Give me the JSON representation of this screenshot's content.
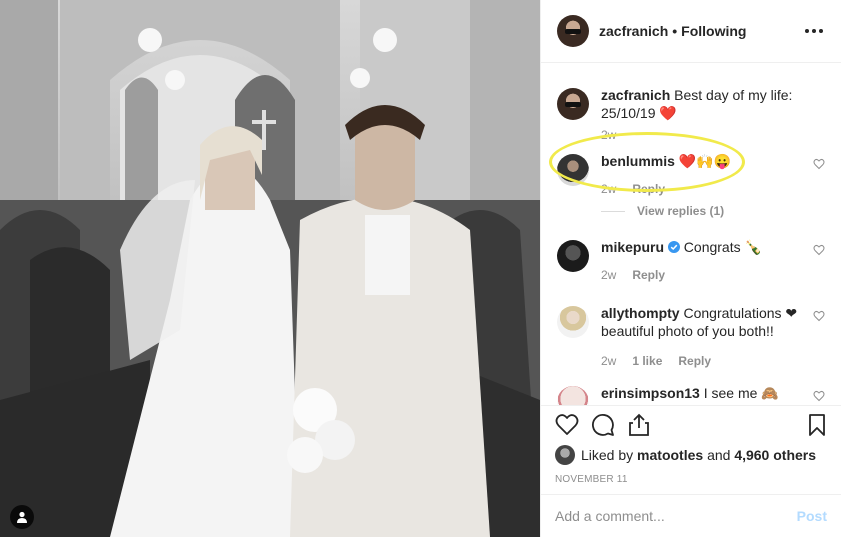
{
  "post": {
    "photo_alt": "",
    "username": "zacfranich",
    "separator": "•",
    "follow_status": "Following",
    "more_icon": "more-options-icon"
  },
  "caption": {
    "username": "zacfranich",
    "text": "Best day of my life: 25/10/19 ❤️",
    "time": "2w"
  },
  "comments": [
    {
      "username": "benlummis",
      "text": "❤️🙌😛",
      "time": "2w",
      "likes": "",
      "reply": "Reply",
      "view_replies": "View replies (1)"
    },
    {
      "username": "mikepuru",
      "text": "Congrats 🍾",
      "time": "2w",
      "likes": "",
      "reply": "Reply",
      "verified": true
    },
    {
      "username": "allythompty",
      "text": "Congratulations ❤ beautiful photo of you both!!",
      "time": "2w",
      "likes": "1 like",
      "reply": "Reply"
    },
    {
      "username": "erinsimpson13",
      "text": "I see me 🙈"
    }
  ],
  "actions": {
    "like_icon": "heart-icon",
    "comment_icon": "comment-icon",
    "share_icon": "share-icon",
    "save_icon": "bookmark-icon"
  },
  "likes": {
    "prefix": "Liked by",
    "first_user": "matootles",
    "conj": "and",
    "others": "4,960 others"
  },
  "date": "NOVEMBER 11",
  "add_comment": {
    "placeholder": "Add a comment...",
    "post_label": "Post"
  },
  "colors": {
    "highlight": "#f1ea4b",
    "link_blue_disabled": "#b3dbff",
    "verified_blue": "#3897f0",
    "heart_red": "#ed4956"
  }
}
